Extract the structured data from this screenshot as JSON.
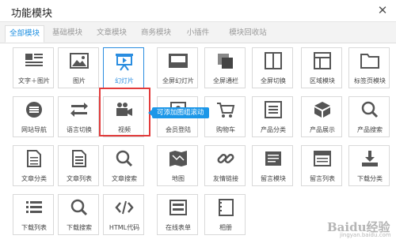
{
  "window": {
    "title": "功能模块",
    "close_glyph": "✕"
  },
  "tabs": [
    {
      "label": "全部模块",
      "active": true
    },
    {
      "label": "基础模块",
      "active": false
    },
    {
      "label": "文章模块",
      "active": false
    },
    {
      "label": "商务模块",
      "active": false
    },
    {
      "label": "小插件",
      "active": false
    },
    {
      "label": "模块回收站",
      "active": false
    }
  ],
  "tooltip": {
    "text": "可添加图组滚动"
  },
  "watermark": {
    "text": "Baidu经验",
    "sub": "jingyan.baidu.com"
  },
  "modules": [
    {
      "label": "文字＋图片",
      "icon": "text-image-icon"
    },
    {
      "label": "图片",
      "icon": "image-icon"
    },
    {
      "label": "幻灯片",
      "icon": "slideshow-icon",
      "selected": true
    },
    {
      "label": "全屏幻灯片",
      "icon": "fullscreen-slideshow-icon"
    },
    {
      "label": "全屏通栏",
      "icon": "fullscreen-banner-icon"
    },
    {
      "label": "全屏切换",
      "icon": "fullscreen-switch-icon"
    },
    {
      "label": "区域模块",
      "icon": "region-module-icon"
    },
    {
      "label": "标签页模块",
      "icon": "tab-page-icon"
    },
    {
      "label": "网站导航",
      "icon": "site-nav-icon"
    },
    {
      "label": "语言切换",
      "icon": "language-switch-icon"
    },
    {
      "label": "视频",
      "icon": "video-icon"
    },
    {
      "label": "会员登陆",
      "icon": "member-login-icon"
    },
    {
      "label": "购物车",
      "icon": "shopping-cart-icon"
    },
    {
      "label": "产品分类",
      "icon": "product-category-icon"
    },
    {
      "label": "产品展示",
      "icon": "product-display-icon"
    },
    {
      "label": "产品搜索",
      "icon": "product-search-icon"
    },
    {
      "label": "文章分类",
      "icon": "article-category-icon"
    },
    {
      "label": "文章列表",
      "icon": "article-list-icon"
    },
    {
      "label": "文章搜索",
      "icon": "article-search-icon"
    },
    {
      "label": "地图",
      "icon": "map-icon"
    },
    {
      "label": "友情链接",
      "icon": "friend-link-icon"
    },
    {
      "label": "留言模块",
      "icon": "message-module-icon"
    },
    {
      "label": "留言列表",
      "icon": "message-list-icon"
    },
    {
      "label": "下载分类",
      "icon": "download-category-icon"
    },
    {
      "label": "下载列表",
      "icon": "download-list-icon"
    },
    {
      "label": "下载搜索",
      "icon": "download-search-icon"
    },
    {
      "label": "HTML代码",
      "icon": "html-code-icon"
    },
    {
      "label": "在线表单",
      "icon": "online-form-icon"
    },
    {
      "label": "相册",
      "icon": "album-icon"
    }
  ]
}
